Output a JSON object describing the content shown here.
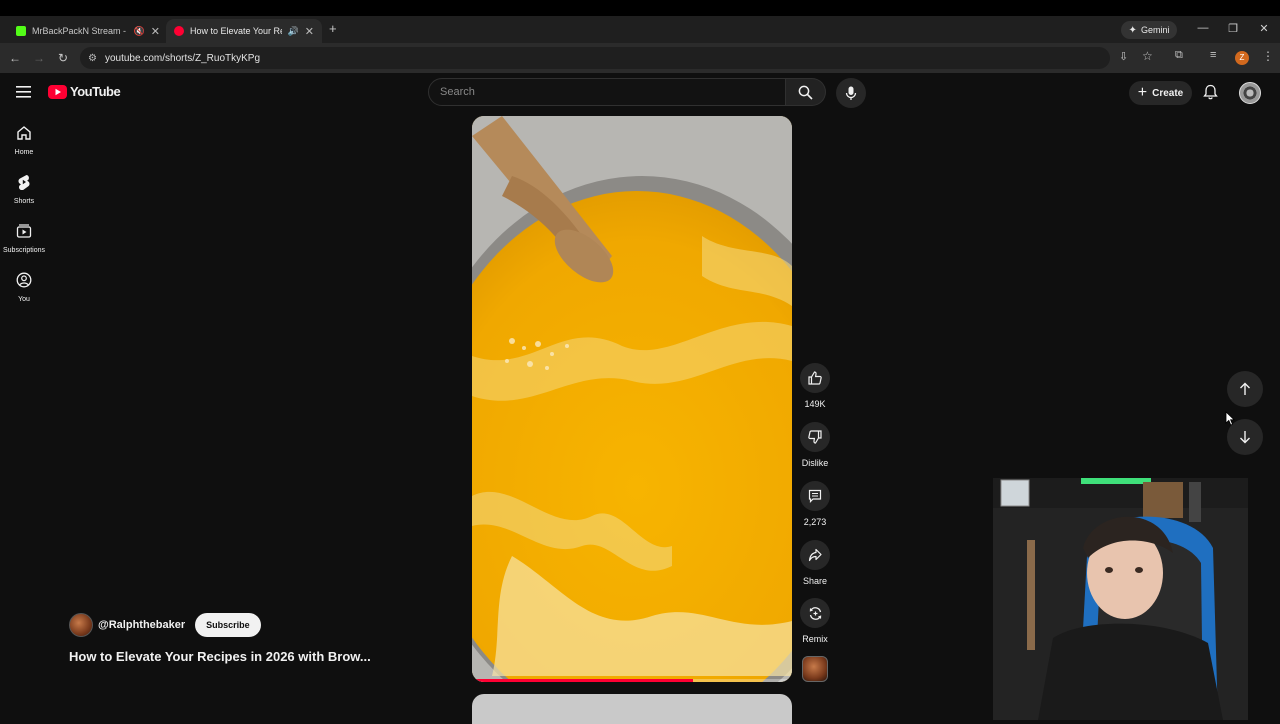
{
  "browser": {
    "tabs": [
      {
        "title": "MrBackPackN Stream - Wat",
        "favicon_color": "#53fc18",
        "active": false,
        "muted": true
      },
      {
        "title": "How to Elevate Your Recipe",
        "favicon_color": "#ff0033",
        "active": true,
        "muted": false
      }
    ],
    "new_tab": "+",
    "url": "youtube.com/shorts/Z_RuoTkyKPg",
    "gemini_label": "Gemini",
    "profile_initial": "Z"
  },
  "youtube": {
    "logo_text": "YouTube",
    "search_placeholder": "Search",
    "create_label": "Create",
    "sidebar": [
      {
        "label": "Home",
        "icon": "home-icon"
      },
      {
        "label": "Shorts",
        "icon": "shorts-icon"
      },
      {
        "label": "Subscriptions",
        "icon": "subscriptions-icon"
      },
      {
        "label": "You",
        "icon": "you-icon"
      }
    ],
    "actions": {
      "like": "149K",
      "dislike": "Dislike",
      "comments": "2,273",
      "share": "Share",
      "remix": "Remix"
    },
    "channel": {
      "handle": "@Ralphthebaker",
      "subscribe_label": "Subscribe"
    },
    "video_title": "How to Elevate Your Recipes in 2026 with Brow...",
    "progress_fraction": 0.69
  },
  "colors": {
    "accent": "#ff0033",
    "video_yellow": "#f0b000"
  }
}
